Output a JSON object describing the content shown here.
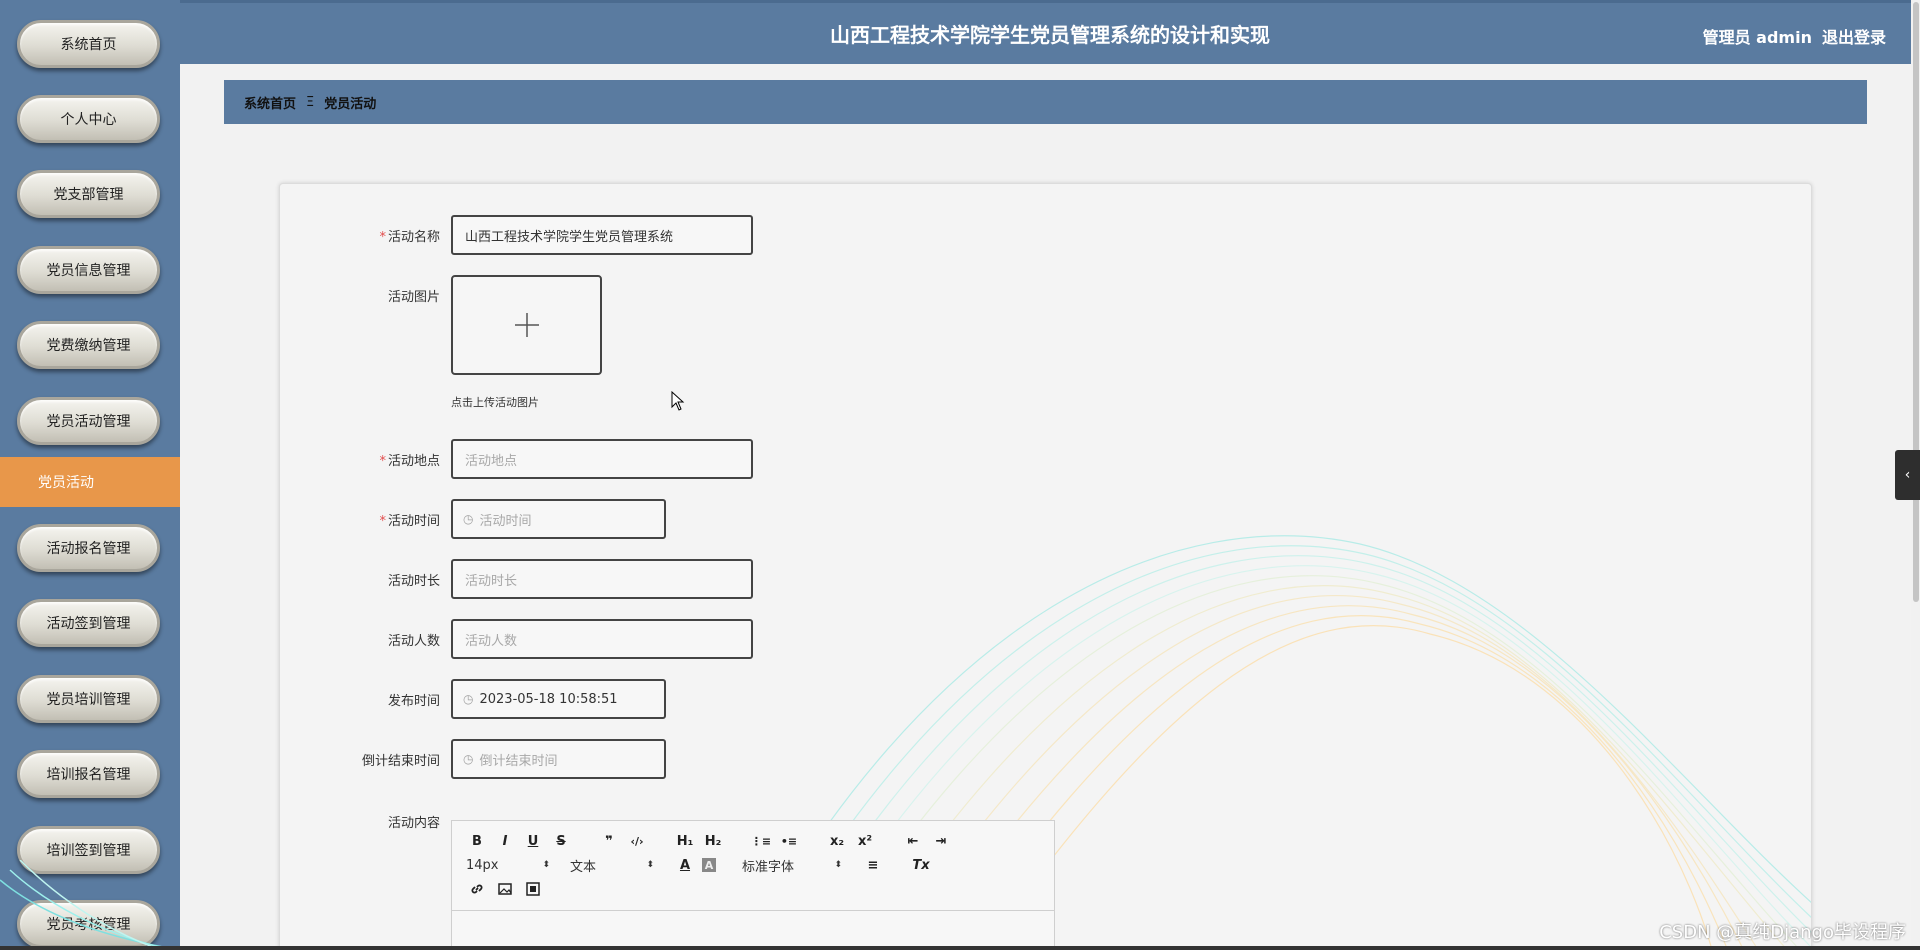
{
  "header": {
    "title": "山西工程技术学院学生党员管理系统的设计和实现",
    "user_label": "管理员 admin",
    "logout": "退出登录"
  },
  "sidebar": {
    "items": [
      {
        "label": "系统首页"
      },
      {
        "label": "个人中心"
      },
      {
        "label": "党支部管理"
      },
      {
        "label": "党员信息管理"
      },
      {
        "label": "党费缴纳管理"
      },
      {
        "label": "党员活动管理"
      },
      {
        "label": "活动报名管理"
      },
      {
        "label": "活动签到管理"
      },
      {
        "label": "党员培训管理"
      },
      {
        "label": "培训报名管理"
      },
      {
        "label": "培训签到管理"
      },
      {
        "label": "党员考核管理"
      }
    ],
    "active_sub": "党员活动"
  },
  "breadcrumb": {
    "home": "系统首页",
    "separator": "Ξ",
    "current": "党员活动"
  },
  "form": {
    "name": {
      "label": "活动名称",
      "value": "山西工程技术学院学生党员管理系统"
    },
    "image": {
      "label": "活动图片",
      "hint": "点击上传活动图片"
    },
    "location": {
      "label": "活动地点",
      "placeholder": "活动地点"
    },
    "time": {
      "label": "活动时间",
      "placeholder": "活动时间"
    },
    "duration": {
      "label": "活动时长",
      "placeholder": "活动时长"
    },
    "count": {
      "label": "活动人数",
      "placeholder": "活动人数"
    },
    "publish_time": {
      "label": "发布时间",
      "value": "2023-05-18 10:58:51"
    },
    "countdown_end": {
      "label": "倒计结束时间",
      "placeholder": "倒计结束时间"
    },
    "content": {
      "label": "活动内容"
    },
    "required_mark": "*"
  },
  "editor": {
    "bold": "B",
    "italic": "I",
    "underline": "U",
    "strike": "S",
    "quote": "❞",
    "code": "‹/›",
    "h1": "H₁",
    "h2": "H₂",
    "ordered_list": "⋮≡",
    "bullet_list": "•≡",
    "sub": "x₂",
    "sup": "x²",
    "outdent": "⇤",
    "indent": "⇥",
    "font_size": "14px",
    "block_type": "文本",
    "font_family": "标准字体",
    "color": "A",
    "background": "A",
    "align": "≡",
    "clear_format": "Tx",
    "link_icon": "link-icon",
    "image_icon": "image-icon",
    "video_icon": "video-icon"
  },
  "watermark": "CSDN @真纯Django毕设程序",
  "colors": {
    "sidebar": "#5a7ba0",
    "active": "#e8974a",
    "header": "#5a7ba0"
  }
}
